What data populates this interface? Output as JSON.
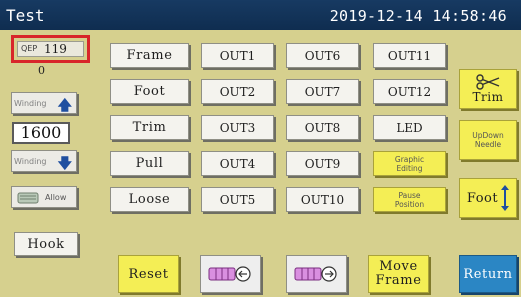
{
  "window": {
    "title": "Test",
    "datetime": "2019-12-14 14:58:46"
  },
  "counter": {
    "label": "QEP",
    "value": "119",
    "sub_value": "0"
  },
  "winding": {
    "up_label": "Winding",
    "down_label": "Winding",
    "value": "1600"
  },
  "allow_label": "Allow",
  "hook_label": "Hook",
  "functions": [
    "Frame",
    "Foot",
    "Trim",
    "Pull",
    "Loose"
  ],
  "outputs_col1": [
    "OUT1",
    "OUT2",
    "OUT3",
    "OUT4",
    "OUT5"
  ],
  "outputs_col2": [
    "OUT6",
    "OUT7",
    "OUT8",
    "OUT9",
    "OUT10"
  ],
  "col4": {
    "out11": "OUT11",
    "out12": "OUT12",
    "led": "LED",
    "graphic_line1": "Graphic",
    "graphic_line2": "Editing",
    "pause_line1": "Pause",
    "pause_line2": "Position"
  },
  "right": {
    "trim": "Trim",
    "updown_line1": "UpDown",
    "updown_line2": "Needle",
    "foot": "Foot"
  },
  "bottom": {
    "reset": "Reset",
    "move_line1": "Move",
    "move_line2": "Frame",
    "return": "Return"
  },
  "icons": {
    "trim": "scissors-icon",
    "bobbin_left": "bobbin-left-icon",
    "bobbin_right": "bobbin-right-icon",
    "allow": "thread-spool-icon",
    "winding_up": "arrow-up-icon",
    "winding_down": "arrow-down-icon",
    "foot": "double-arrow-icon"
  },
  "colors": {
    "background": "#d6d08e",
    "title_bar": "#173a62",
    "highlight_yellow": "#f4ee55",
    "return_blue": "#2b86c4",
    "qep_frame": "#d8262a"
  }
}
